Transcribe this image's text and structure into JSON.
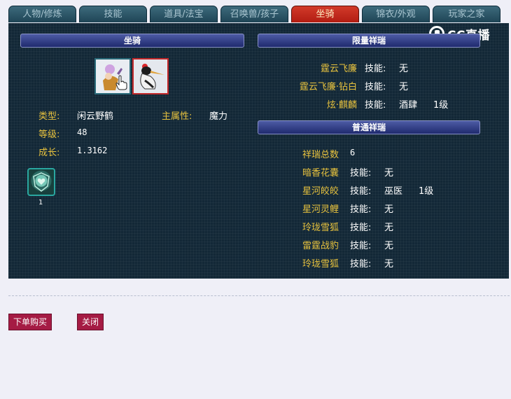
{
  "tabs": [
    {
      "label": "人物/修炼"
    },
    {
      "label": "技能"
    },
    {
      "label": "道具/法宝"
    },
    {
      "label": "召唤兽/孩子"
    },
    {
      "label": "坐骑",
      "active": true
    },
    {
      "label": "锦衣/外观"
    },
    {
      "label": "玩家之家"
    }
  ],
  "watermark": {
    "text": "CC直播"
  },
  "mount": {
    "header": "坐骑",
    "type_label": "类型:",
    "type_value": "闲云野鹤",
    "attr_label": "主属性:",
    "attr_value": "魔力",
    "level_label": "等级:",
    "level_value": "48",
    "growth_label": "成长:",
    "growth_value": "1.3162",
    "skill_count": "1",
    "skill_icon": "mount-skill-icon"
  },
  "limited": {
    "header": "限量祥瑞",
    "items": [
      {
        "name": "霆云飞廉",
        "skill_label": "技能:",
        "skill": "无",
        "level": ""
      },
      {
        "name": "霆云飞廉·钻白",
        "skill_label": "技能:",
        "skill": "无",
        "level": ""
      },
      {
        "name": "炫·麒麟",
        "skill_label": "技能:",
        "skill": "酒肆",
        "level": "1级"
      }
    ]
  },
  "normal": {
    "header": "普通祥瑞",
    "total_label": "祥瑞总数",
    "total_value": "6",
    "items": [
      {
        "name": "暗香花囊",
        "skill_label": "技能:",
        "skill": "无",
        "level": ""
      },
      {
        "name": "星河皎皎",
        "skill_label": "技能:",
        "skill": "巫医",
        "level": "1级"
      },
      {
        "name": "星河灵鲤",
        "skill_label": "技能:",
        "skill": "无",
        "level": ""
      },
      {
        "name": "玲珑雪狐",
        "skill_label": "技能:",
        "skill": "无",
        "level": ""
      },
      {
        "name": "雷霆战豹",
        "skill_label": "技能:",
        "skill": "无",
        "level": ""
      },
      {
        "name": "玲珑雪狐",
        "skill_label": "技能:",
        "skill": "无",
        "level": ""
      }
    ]
  },
  "buttons": {
    "buy": "下单购买",
    "close": "关闭"
  },
  "colors": {
    "panel": "#132837",
    "label_yellow": "#e7c23e",
    "active_tab": "#c42a1c",
    "button": "#a51b44"
  }
}
